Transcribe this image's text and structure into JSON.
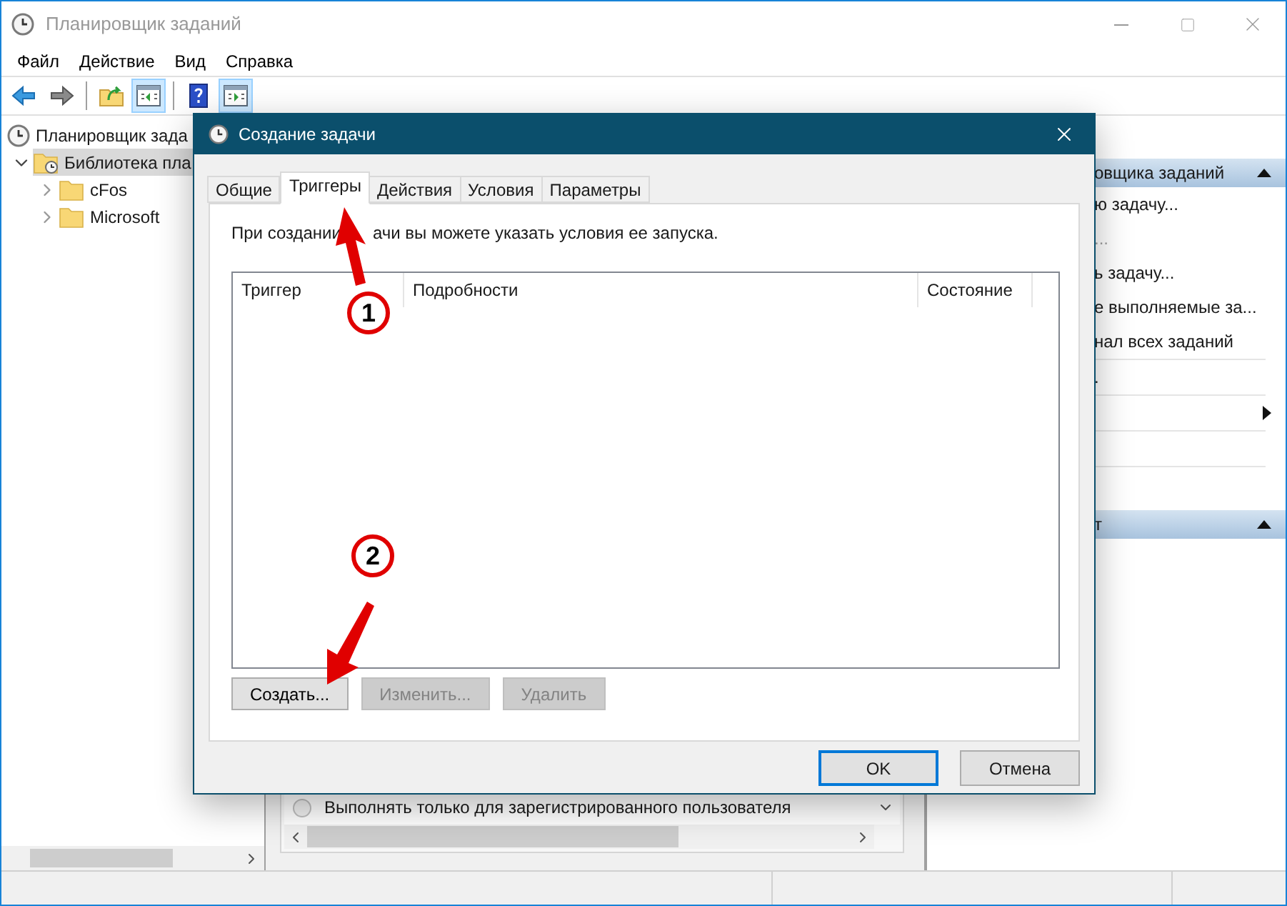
{
  "window": {
    "title": "Планировщик заданий"
  },
  "menu": [
    "Файл",
    "Действие",
    "Вид",
    "Справка"
  ],
  "toolbar": [
    {
      "kind": "back",
      "selected": false
    },
    {
      "kind": "forward",
      "selected": false
    },
    {
      "kind": "sep"
    },
    {
      "kind": "up",
      "selected": false
    },
    {
      "kind": "pane-left",
      "selected": true
    },
    {
      "kind": "sep"
    },
    {
      "kind": "help",
      "selected": false
    },
    {
      "kind": "pane-right",
      "selected": true
    }
  ],
  "tree": [
    {
      "label": "Планировщик зада",
      "kind": "root",
      "selected": false,
      "children": [
        {
          "label": "Библиотека пла",
          "kind": "library",
          "expanded": true,
          "selected": true,
          "children": [
            {
              "label": "cFos",
              "kind": "folder",
              "expanded": false,
              "selected": false
            },
            {
              "label": "Microsoft",
              "kind": "folder",
              "expanded": false,
              "selected": false
            }
          ]
        }
      ]
    }
  ],
  "middle": {
    "radio": {
      "label": "Выполнять только для зарегистрированного пользователя",
      "selected": false,
      "disabled": true
    }
  },
  "actions": [
    {
      "kind": "header",
      "label": "овщика заданий",
      "expanded": true
    },
    {
      "kind": "item",
      "label": "ю задачу...",
      "disabled": false
    },
    {
      "kind": "item",
      "label": "...",
      "disabled": true
    },
    {
      "kind": "item",
      "label": "ь задачу...",
      "disabled": false
    },
    {
      "kind": "item",
      "label": "е выполняемые за...",
      "disabled": false
    },
    {
      "kind": "item",
      "label": "нал всех заданий",
      "disabled": false
    },
    {
      "kind": "sep"
    },
    {
      "kind": "item",
      "label": ".",
      "disabled": false
    },
    {
      "kind": "sep"
    },
    {
      "kind": "submenu"
    },
    {
      "kind": "sep"
    },
    {
      "kind": "blank"
    },
    {
      "kind": "sep"
    },
    {
      "kind": "blank"
    },
    {
      "kind": "header",
      "label": "т",
      "expanded": true
    }
  ],
  "dialog": {
    "title": "Создание задачи",
    "tabs": [
      {
        "label": "Общие",
        "selected": false
      },
      {
        "label": "Триггеры",
        "selected": true
      },
      {
        "label": "Действия",
        "selected": false
      },
      {
        "label": "Условия",
        "selected": false
      },
      {
        "label": "Параметры",
        "selected": false
      }
    ],
    "hint": [
      "При создании",
      "ачи вы можете указать условия ее запуска."
    ],
    "table": {
      "columns": [
        "Триггер",
        "Подробности",
        "Состояние"
      ]
    },
    "buttons": [
      {
        "label": "Создать...",
        "disabled": false
      },
      {
        "label": "Изменить...",
        "disabled": true
      },
      {
        "label": "Удалить",
        "disabled": true
      }
    ],
    "footer": [
      {
        "label": "OK",
        "default": true
      },
      {
        "label": "Отмена",
        "default": false
      }
    ]
  },
  "annotations": [
    {
      "label": "1"
    },
    {
      "label": "2"
    }
  ]
}
